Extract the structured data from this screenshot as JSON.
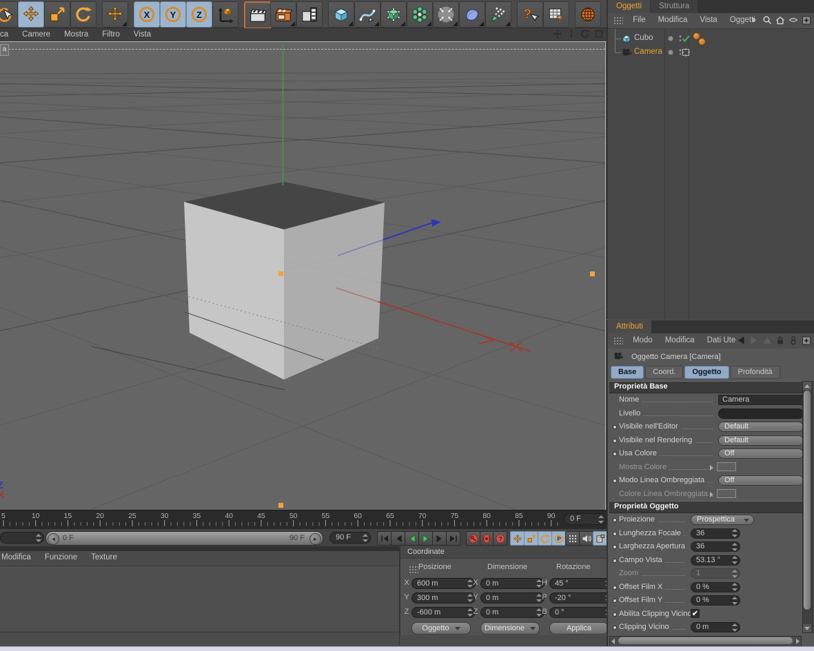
{
  "toolbar": {
    "buttons": [
      {
        "name": "live-selection-tool",
        "icon": "live",
        "cut": true
      },
      {
        "name": "move-tool",
        "icon": "move",
        "selected": true
      },
      {
        "name": "scale-tool",
        "icon": "scale"
      },
      {
        "name": "rotate-tool",
        "icon": "rotate"
      },
      {
        "name": "last-used-tool",
        "icon": "move",
        "more": true,
        "gap": true
      },
      {
        "name": "axis-x-lock",
        "icon": "axisX",
        "selected": true,
        "gap": true
      },
      {
        "name": "axis-y-lock",
        "icon": "axisY",
        "selected": true
      },
      {
        "name": "axis-z-lock",
        "icon": "axisZ",
        "selected": true
      },
      {
        "name": "coordinate-system-toggle",
        "icon": "coordsys"
      },
      {
        "name": "render-active-view",
        "icon": "renderview",
        "accent": true,
        "gap": true
      },
      {
        "name": "render-picture-viewer",
        "icon": "renderpic",
        "more": true
      },
      {
        "name": "render-settings",
        "icon": "rendersettings"
      },
      {
        "name": "add-primitive-object",
        "icon": "cubeblue",
        "more": true,
        "gap": true
      },
      {
        "name": "add-spline",
        "icon": "spline",
        "more": true
      },
      {
        "name": "add-nurbs-object",
        "icon": "nurbs",
        "more": true
      },
      {
        "name": "add-modeling-object",
        "icon": "modeling",
        "more": true
      },
      {
        "name": "add-deformer",
        "icon": "deformer",
        "more": true
      },
      {
        "name": "add-scene-object",
        "icon": "sceneobj",
        "more": true
      },
      {
        "name": "add-particle-object",
        "icon": "particles",
        "more": true
      },
      {
        "name": "help",
        "icon": "help",
        "gap": true
      },
      {
        "name": "command-manager",
        "icon": "cmdtable"
      },
      {
        "name": "content-browser",
        "icon": "globe",
        "gap": true
      }
    ]
  },
  "viewport_menu": {
    "items": [
      "ca",
      "Camere",
      "Mostra",
      "Filtro",
      "Vista"
    ]
  },
  "viewport": {
    "view_label": "a",
    "axis_x_label": "X",
    "axis_z_label": "Z"
  },
  "timeline": {
    "tick_min": 5,
    "tick_max": 90,
    "tick_step": 5,
    "current_frame": "0 F",
    "range_start_label": "0 F",
    "range_end_label": "90 F",
    "end_field": "90 F",
    "left_field": ""
  },
  "transport": {
    "playback": [
      "goto-start",
      "previous-key",
      "play-backward",
      "play-forward",
      "next-key",
      "goto-end"
    ],
    "record": [
      "record-keyframe",
      "autokey",
      "record-options"
    ],
    "toggles": [
      {
        "name": "keyframe-position",
        "icon": "kmove",
        "on": true
      },
      {
        "name": "keyframe-scale",
        "icon": "kscale",
        "on": true
      },
      {
        "name": "keyframe-rotation",
        "icon": "krot",
        "on": true
      },
      {
        "name": "keyframe-parameter",
        "icon": "kparam",
        "on": true
      },
      {
        "name": "keyframe-points",
        "icon": "kpoints",
        "on": false
      },
      {
        "name": "sound-toggle",
        "icon": "ksound",
        "on": false
      },
      {
        "name": "document-keyframe",
        "icon": "kdoc",
        "on": true
      }
    ]
  },
  "materials": {
    "menu": [
      "Modifica",
      "Funzione",
      "Texture"
    ]
  },
  "coordinates": {
    "title": "Coordinate",
    "headers": [
      "Posizione",
      "Dimensione",
      "Rotazione"
    ],
    "groups": [
      {
        "rows": [
          {
            "axis": "X",
            "value": "600 m"
          },
          {
            "axis": "Y",
            "value": "300 m"
          },
          {
            "axis": "Z",
            "value": "-600 m"
          }
        ],
        "button": "Oggetto",
        "arrow": true
      },
      {
        "rows": [
          {
            "axis": "X",
            "value": "0 m"
          },
          {
            "axis": "Y",
            "value": "0 m"
          },
          {
            "axis": "Z",
            "value": "0 m"
          }
        ],
        "button": "Dimensione",
        "arrow": true
      },
      {
        "rows": [
          {
            "axis": "H",
            "value": "45 °"
          },
          {
            "axis": "P",
            "value": "-20 °"
          },
          {
            "axis": "B",
            "value": "0 °"
          }
        ],
        "button": "Applica",
        "arrow": false
      }
    ]
  },
  "object_manager": {
    "tabs": [
      {
        "label": "Oggetti",
        "active": true
      },
      {
        "label": "Struttura",
        "active": false
      }
    ],
    "menu": [
      "File",
      "Modifica",
      "Vista",
      "Oggetti"
    ],
    "objects": [
      {
        "name": "Cubo",
        "icon": "objcube",
        "state": "check",
        "selected": false,
        "material_tags": 2
      },
      {
        "name": "Camera",
        "icon": "objcam",
        "state": "target",
        "selected": true,
        "material_tags": 0
      }
    ]
  },
  "attributes": {
    "tab": "Attributi",
    "menu": [
      "Modo",
      "Modifica",
      "Dati Ute"
    ],
    "object_title": "Oggetto Camera [Camera]",
    "tabs": [
      {
        "label": "Base",
        "active": true
      },
      {
        "label": "Coord.",
        "active": false
      },
      {
        "label": "Oggetto",
        "active": true
      },
      {
        "label": "Profondità",
        "active": false
      }
    ],
    "sections": [
      {
        "title": "Proprietà Base",
        "layout": "base",
        "rows": [
          {
            "dot": false,
            "label": "Nome",
            "control": {
              "type": "text",
              "value": "Camera"
            }
          },
          {
            "dot": false,
            "label": "Livello",
            "control": {
              "type": "pill",
              "value": ""
            }
          },
          {
            "dot": true,
            "label": "Visibile nell'Editor",
            "control": {
              "type": "dropdown",
              "value": "Default"
            }
          },
          {
            "dot": true,
            "label": "Visibile nel Rendering",
            "control": {
              "type": "dropdown",
              "value": "Default"
            }
          },
          {
            "dot": true,
            "label": "Usa Colore",
            "control": {
              "type": "dropdown",
              "value": "Off"
            }
          },
          {
            "dot": false,
            "label": "Mostra Colore",
            "disabled": true,
            "arrow": true,
            "control": {
              "type": "swatch"
            }
          },
          {
            "dot": true,
            "label": "Modo Linea Ombreggiata",
            "control": {
              "type": "dropdown",
              "value": "Off"
            }
          },
          {
            "dot": false,
            "label": "Colore Linea Ombreggiata",
            "disabled": true,
            "arrow": true,
            "control": {
              "type": "swatch"
            }
          }
        ]
      },
      {
        "title": "Proprietà Oggetto",
        "layout": "obj",
        "rows": [
          {
            "dot": true,
            "label": "Proiezione",
            "control": {
              "type": "select",
              "value": "Prospettica"
            }
          },
          {
            "dot": true,
            "label": "Lunghezza Focale",
            "control": {
              "type": "number",
              "value": "36"
            }
          },
          {
            "dot": true,
            "label": "Larghezza Apertura",
            "control": {
              "type": "number",
              "value": "36"
            }
          },
          {
            "dot": true,
            "label": "Campo Vista",
            "control": {
              "type": "number",
              "value": "53.13 °"
            }
          },
          {
            "dot": false,
            "label": "Zoom",
            "disabled": true,
            "control": {
              "type": "number",
              "value": "1",
              "disabled": true
            }
          },
          {
            "dot": true,
            "label": "Offset Film X",
            "control": {
              "type": "number",
              "value": "0 %"
            }
          },
          {
            "dot": true,
            "label": "Offset Film Y",
            "control": {
              "type": "number",
              "value": "0 %"
            }
          },
          {
            "dot": true,
            "label": "Abilita Clipping Vicino",
            "control": {
              "type": "checkbox",
              "checked": true
            }
          },
          {
            "dot": true,
            "label": "Clipping Vicino",
            "control": {
              "type": "number",
              "value": "0 m"
            }
          }
        ]
      }
    ]
  },
  "colors": {
    "accent_orange": "#eda52f",
    "selected_blue": "#9cb4cc",
    "axis_x": "#b03328",
    "axis_y": "#3f9e3f",
    "axis_z": "#2a35b8",
    "handle": "#f2a43a"
  }
}
